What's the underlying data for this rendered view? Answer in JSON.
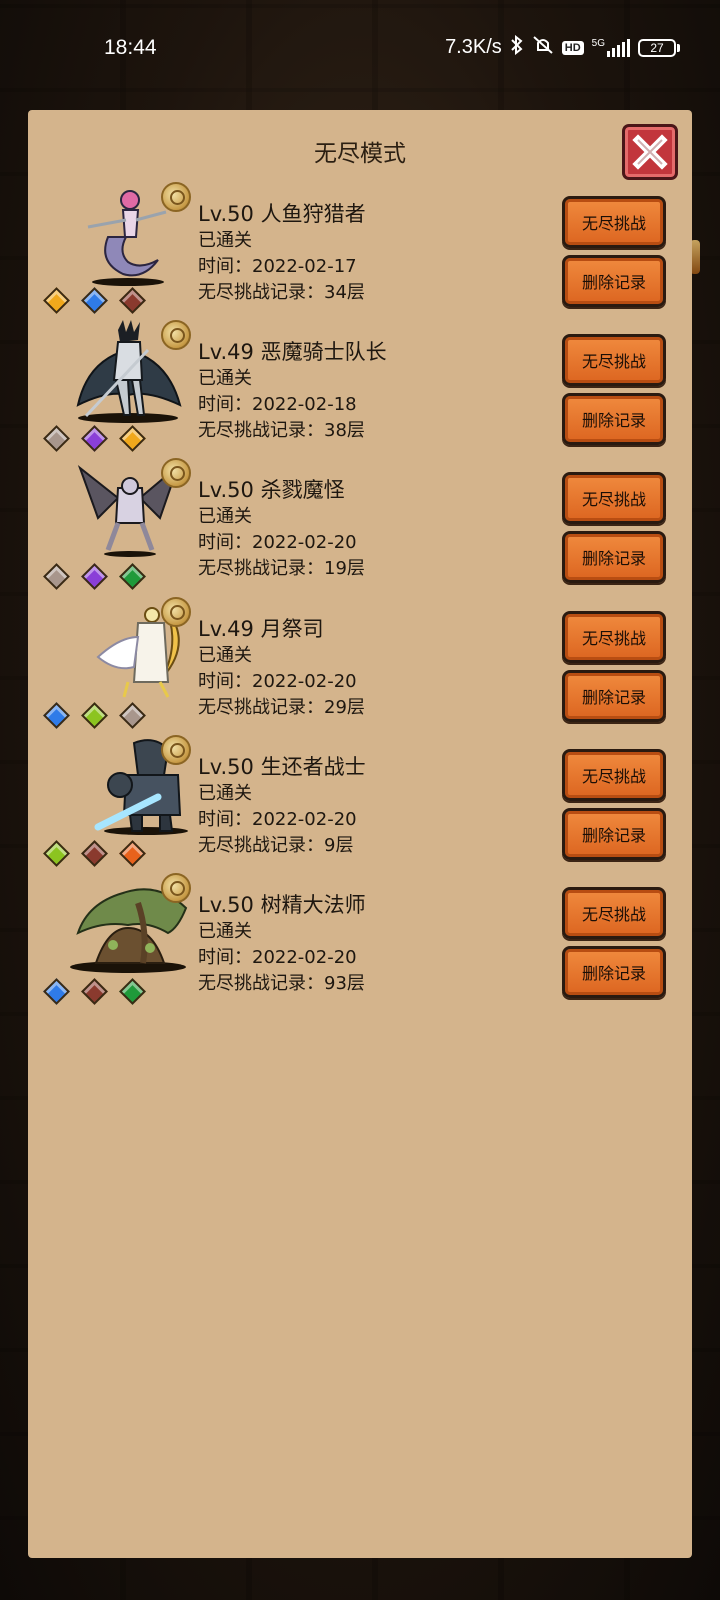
{
  "status_bar": {
    "time": "18:44",
    "net_speed": "7.3K/s",
    "hd": "HD",
    "signal": "5G",
    "battery": "27",
    "icons": [
      "bluetooth-icon",
      "mute-icon",
      "hd-icon",
      "signal-5g-icon",
      "battery-icon"
    ]
  },
  "panel": {
    "title": "无尽模式",
    "close_icon": "close-icon"
  },
  "entries": [
    {
      "name": "Lv.50 人鱼狩猎者",
      "status": "已通关",
      "time": "时间：2022-02-17",
      "record": "无尽挑战记录：34层",
      "gems": [
        "#f0a81c",
        "#2f7be8",
        "#8a3a2e"
      ],
      "challenge_label": "无尽挑战",
      "delete_label": "删除记录"
    },
    {
      "name": "Lv.49 恶魔骑士队长",
      "status": "已通关",
      "time": "时间：2022-02-18",
      "record": "无尽挑战记录：38层",
      "gems": [
        "#a8968c",
        "#8a3fd8",
        "#f0a81c"
      ],
      "challenge_label": "无尽挑战",
      "delete_label": "删除记录"
    },
    {
      "name": "Lv.50 杀戮魔怪",
      "status": "已通关",
      "time": "时间：2022-02-20",
      "record": "无尽挑战记录：19层",
      "gems": [
        "#a8968c",
        "#8a3fd8",
        "#1f9a3a"
      ],
      "challenge_label": "无尽挑战",
      "delete_label": "删除记录"
    },
    {
      "name": "Lv.49 月祭司",
      "status": "已通关",
      "time": "时间：2022-02-20",
      "record": "无尽挑战记录：29层",
      "gems": [
        "#2f7be8",
        "#8cc420",
        "#a8968c"
      ],
      "challenge_label": "无尽挑战",
      "delete_label": "删除记录"
    },
    {
      "name": "Lv.50 生还者战士",
      "status": "已通关",
      "time": "时间：2022-02-20",
      "record": "无尽挑战记录：9层",
      "gems": [
        "#8cc420",
        "#8a3a2e",
        "#e8621c"
      ],
      "challenge_label": "无尽挑战",
      "delete_label": "删除记录"
    },
    {
      "name": "Lv.50 树精大法师",
      "status": "已通关",
      "time": "时间：2022-02-20",
      "record": "无尽挑战记录：93层",
      "gems": [
        "#2f7be8",
        "#8a3a2e",
        "#1f9a3a"
      ],
      "challenge_label": "无尽挑战",
      "delete_label": "删除记录"
    }
  ],
  "colors": {
    "panel_bg": "#d4b48c",
    "button_orange": "#e8702a",
    "close_red": "#c2363c"
  }
}
